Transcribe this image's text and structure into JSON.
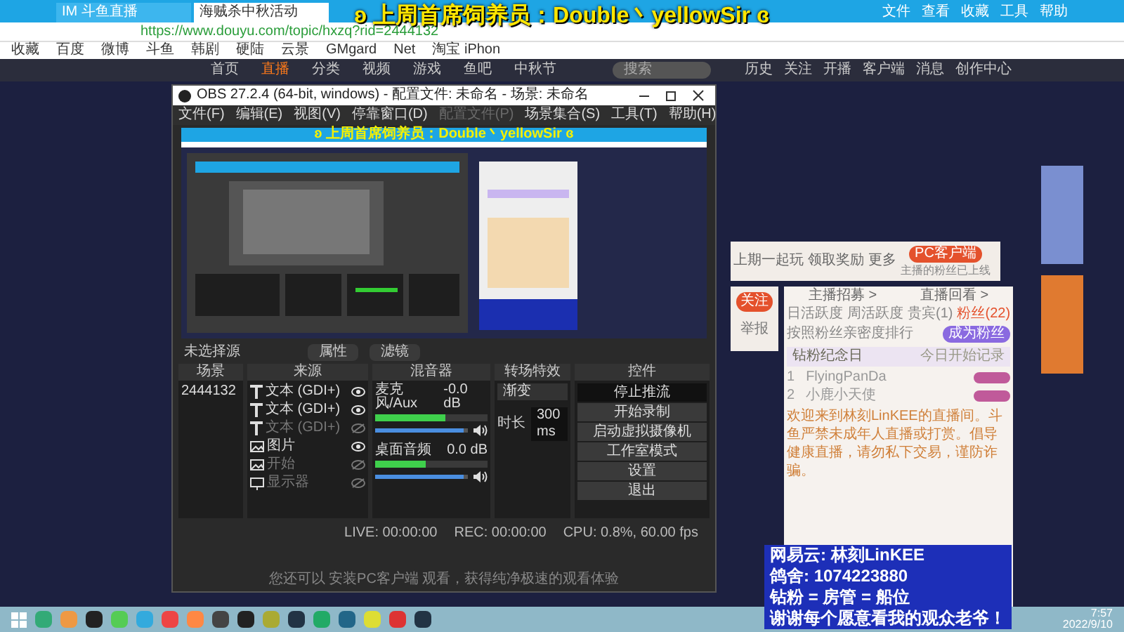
{
  "overlay_title": "ʚ 上周首席饲养员：Double丶yellowSir ɞ",
  "browser": {
    "tabs": [
      {
        "label": "IM 斗鱼直播",
        "selected": false
      },
      {
        "label": "海贼杀中秋活动",
        "selected": true
      }
    ],
    "menu": [
      "文件",
      "查看",
      "收藏",
      "工具",
      "帮助"
    ],
    "url": "https://www.douyu.com/topic/hxzq?rid=2444132",
    "bookmarks": [
      "收藏",
      "百度",
      "微博",
      "斗鱼",
      "韩剧",
      "硬陆",
      "云景",
      "GMgard",
      "Net",
      "淘宝 iPhon"
    ]
  },
  "site_nav": {
    "items": [
      {
        "label": "首页",
        "selected": false
      },
      {
        "label": "直播",
        "selected": true
      },
      {
        "label": "分类",
        "selected": false
      },
      {
        "label": "视频",
        "selected": false
      },
      {
        "label": "游戏",
        "selected": false
      },
      {
        "label": "鱼吧",
        "selected": false
      },
      {
        "label": "中秋节",
        "selected": false
      }
    ],
    "search_placeholder": "搜索",
    "actions": [
      "历史",
      "关注",
      "开播",
      "客户端",
      "消息",
      "创作中心"
    ]
  },
  "obs": {
    "title": "OBS 27.2.4 (64-bit, windows) - 配置文件: 未命名 - 场景: 未命名",
    "menu": [
      {
        "label": "文件(F)",
        "disabled": false
      },
      {
        "label": "编辑(E)",
        "disabled": false
      },
      {
        "label": "视图(V)",
        "disabled": false
      },
      {
        "label": "停靠窗口(D)",
        "disabled": false
      },
      {
        "label": "配置文件(P)",
        "disabled": true
      },
      {
        "label": "场景集合(S)",
        "disabled": false
      },
      {
        "label": "工具(T)",
        "disabled": false
      },
      {
        "label": "帮助(H)",
        "disabled": false
      }
    ],
    "preview_title": "ʚ 上周首席饲养员：Double丶yellowSir ɞ",
    "source_status": "未选择源",
    "source_buttons": [
      "属性",
      "滤镜"
    ],
    "headers": [
      "场景",
      "来源",
      "混音器",
      "转场特效",
      "控件"
    ],
    "scenes": [
      {
        "name": "2444132",
        "selected": false
      }
    ],
    "sources": [
      {
        "kind": "text",
        "name": "文本 (GDI+)",
        "visible": true
      },
      {
        "kind": "text",
        "name": "文本 (GDI+)",
        "visible": true
      },
      {
        "kind": "text",
        "name": "文本 (GDI+)",
        "visible": false
      },
      {
        "kind": "image",
        "name": "图片",
        "visible": true
      },
      {
        "kind": "image",
        "name": "开始",
        "visible": false
      },
      {
        "kind": "display",
        "name": "显示器",
        "visible": false
      }
    ],
    "mixer": [
      {
        "name": "麦克风/Aux",
        "reading": "-0.0 dB",
        "meter": {
          "level": 0.63
        },
        "volume": {
          "level": 0.95
        }
      },
      {
        "name": "桌面音频",
        "reading": "0.0 dB",
        "meter": {
          "level": 0.45
        },
        "volume": {
          "level": 0.95
        }
      }
    ],
    "transition": {
      "value": "渐变",
      "duration_label": "时长",
      "duration": "300 ms"
    },
    "controls": [
      {
        "label": "停止推流",
        "active": true
      },
      {
        "label": "开始录制",
        "active": false
      },
      {
        "label": "启动虚拟摄像机",
        "active": false
      },
      {
        "label": "工作室模式",
        "active": false
      },
      {
        "label": "设置",
        "active": false
      },
      {
        "label": "退出",
        "active": false
      }
    ],
    "status": [
      "LIVE: 00:00:00",
      "REC: 00:00:00",
      "CPU: 0.8%, 60.00 fps"
    ]
  },
  "page_hint": "您还可以 安装PC客户端 观看，获得纯净极速的观看体验",
  "side": {
    "actions": [
      "上期一起玩",
      "领取奖励",
      "更多"
    ],
    "pc_button": "PC客户端",
    "pc_note": "主播的粉丝已上线",
    "follow": "关注",
    "report": "举报",
    "links": [
      "主播招募 >",
      "直播回看 >"
    ],
    "tabs": [
      {
        "label": "日活跃度",
        "selected": false
      },
      {
        "label": "周活跃度",
        "selected": false
      },
      {
        "label": "贵宾(1)",
        "selected": false
      },
      {
        "label": "粉丝(22)",
        "selected": true
      }
    ],
    "rank_note": "按照粉丝亲密度排行",
    "rank_button": "成为粉丝",
    "badge_title": "钻粉纪念日",
    "badge_note": "今日开始记录",
    "users": [
      {
        "rank": "1",
        "name": "FlyingPanDa"
      },
      {
        "rank": "2",
        "name": "小鹿小天使"
      }
    ],
    "notice": "欢迎来到林刻LinKEE的直播间。斗鱼严禁未成年人直播或打赏。倡导健康直播，请勿私下交易，谨防诈骗。"
  },
  "stream_overlay": [
    "网易云: 林刻LinKEE",
    "鸽舍: 1074223880",
    "钻粉 = 房管 = 船位",
    "谢谢每个愿意看我的观众老爷！"
  ],
  "taskbar": {
    "time": "7:57",
    "date": "2022/9/10"
  }
}
